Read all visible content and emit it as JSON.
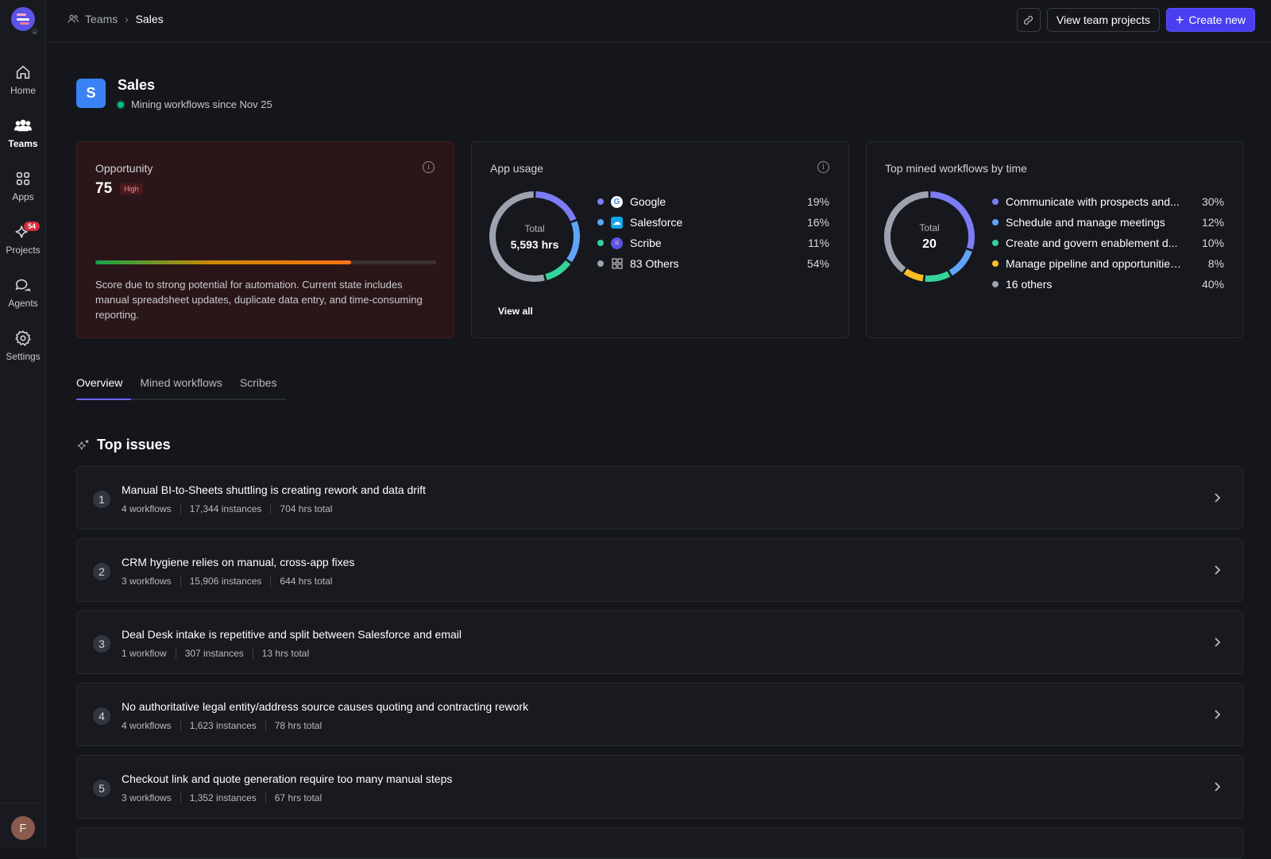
{
  "sidebar": {
    "avatar_initial": "F",
    "items": [
      {
        "label": "Home",
        "icon": "home-icon"
      },
      {
        "label": "Teams",
        "icon": "teams-icon"
      },
      {
        "label": "Apps",
        "icon": "apps-grid-icon"
      },
      {
        "label": "Projects",
        "icon": "sparkle-icon",
        "badge": "54"
      },
      {
        "label": "Agents",
        "icon": "chat-bubbles-icon"
      },
      {
        "label": "Settings",
        "icon": "gear-icon"
      }
    ]
  },
  "breadcrumb": {
    "parent": "Teams",
    "current": "Sales"
  },
  "actions": {
    "view_projects": "View team projects",
    "create_new": "Create new"
  },
  "team": {
    "initial": "S",
    "name": "Sales",
    "status": "Mining workflows since Nov 25",
    "status_color": "#10b981"
  },
  "opportunity": {
    "title": "Opportunity",
    "score": "75",
    "level": "High",
    "progress": 0.75,
    "description": "Score due to strong potential for automation. Current state includes manual spreadsheet updates, duplicate data entry, and time-consuming reporting."
  },
  "app_usage": {
    "title": "App usage",
    "total_label": "Total",
    "total_value": "5,593 hrs",
    "view_all": "View all",
    "items": [
      {
        "name": "Google",
        "pct": "19%",
        "color": "#7c7cf5",
        "icon": "google-icon"
      },
      {
        "name": "Salesforce",
        "pct": "16%",
        "color": "#60a5fa",
        "icon": "salesforce-icon"
      },
      {
        "name": "Scribe",
        "pct": "11%",
        "color": "#34d399",
        "icon": "scribe-icon"
      },
      {
        "name": "83 Others",
        "pct": "54%",
        "color": "#9ca3af",
        "icon": "grid-icon"
      }
    ]
  },
  "top_workflows": {
    "title": "Top mined workflows by time",
    "total_label": "Total",
    "total_value": "20",
    "items": [
      {
        "name": "Communicate with prospects and...",
        "pct": "30%",
        "color": "#7c7cf5"
      },
      {
        "name": "Schedule and manage meetings",
        "pct": "12%",
        "color": "#60a5fa"
      },
      {
        "name": "Create and govern enablement d...",
        "pct": "10%",
        "color": "#34d399"
      },
      {
        "name": "Manage pipeline and opportunities...",
        "pct": "8%",
        "color": "#fbbf24"
      },
      {
        "name": "16 others",
        "pct": "40%",
        "color": "#9ca3af"
      }
    ]
  },
  "tabs": [
    "Overview",
    "Mined workflows",
    "Scribes"
  ],
  "issues": {
    "title": "Top issues",
    "items": [
      {
        "num": "1",
        "title": "Manual BI-to-Sheets shuttling is creating rework and data drift",
        "workflows": "4 workflows",
        "instances": "17,344 instances",
        "hours": "704 hrs total"
      },
      {
        "num": "2",
        "title": "CRM hygiene relies on manual, cross-app fixes",
        "workflows": "3 workflows",
        "instances": "15,906 instances",
        "hours": "644 hrs total"
      },
      {
        "num": "3",
        "title": "Deal Desk intake is repetitive and split between Salesforce and email",
        "workflows": "1 workflow",
        "instances": "307 instances",
        "hours": "13 hrs total"
      },
      {
        "num": "4",
        "title": "No authoritative legal entity/address source causes quoting and contracting rework",
        "workflows": "4 workflows",
        "instances": "1,623 instances",
        "hours": "78 hrs total"
      },
      {
        "num": "5",
        "title": "Checkout link and quote generation require too many manual steps",
        "workflows": "3 workflows",
        "instances": "1,352 instances",
        "hours": "67 hrs total"
      }
    ]
  }
}
